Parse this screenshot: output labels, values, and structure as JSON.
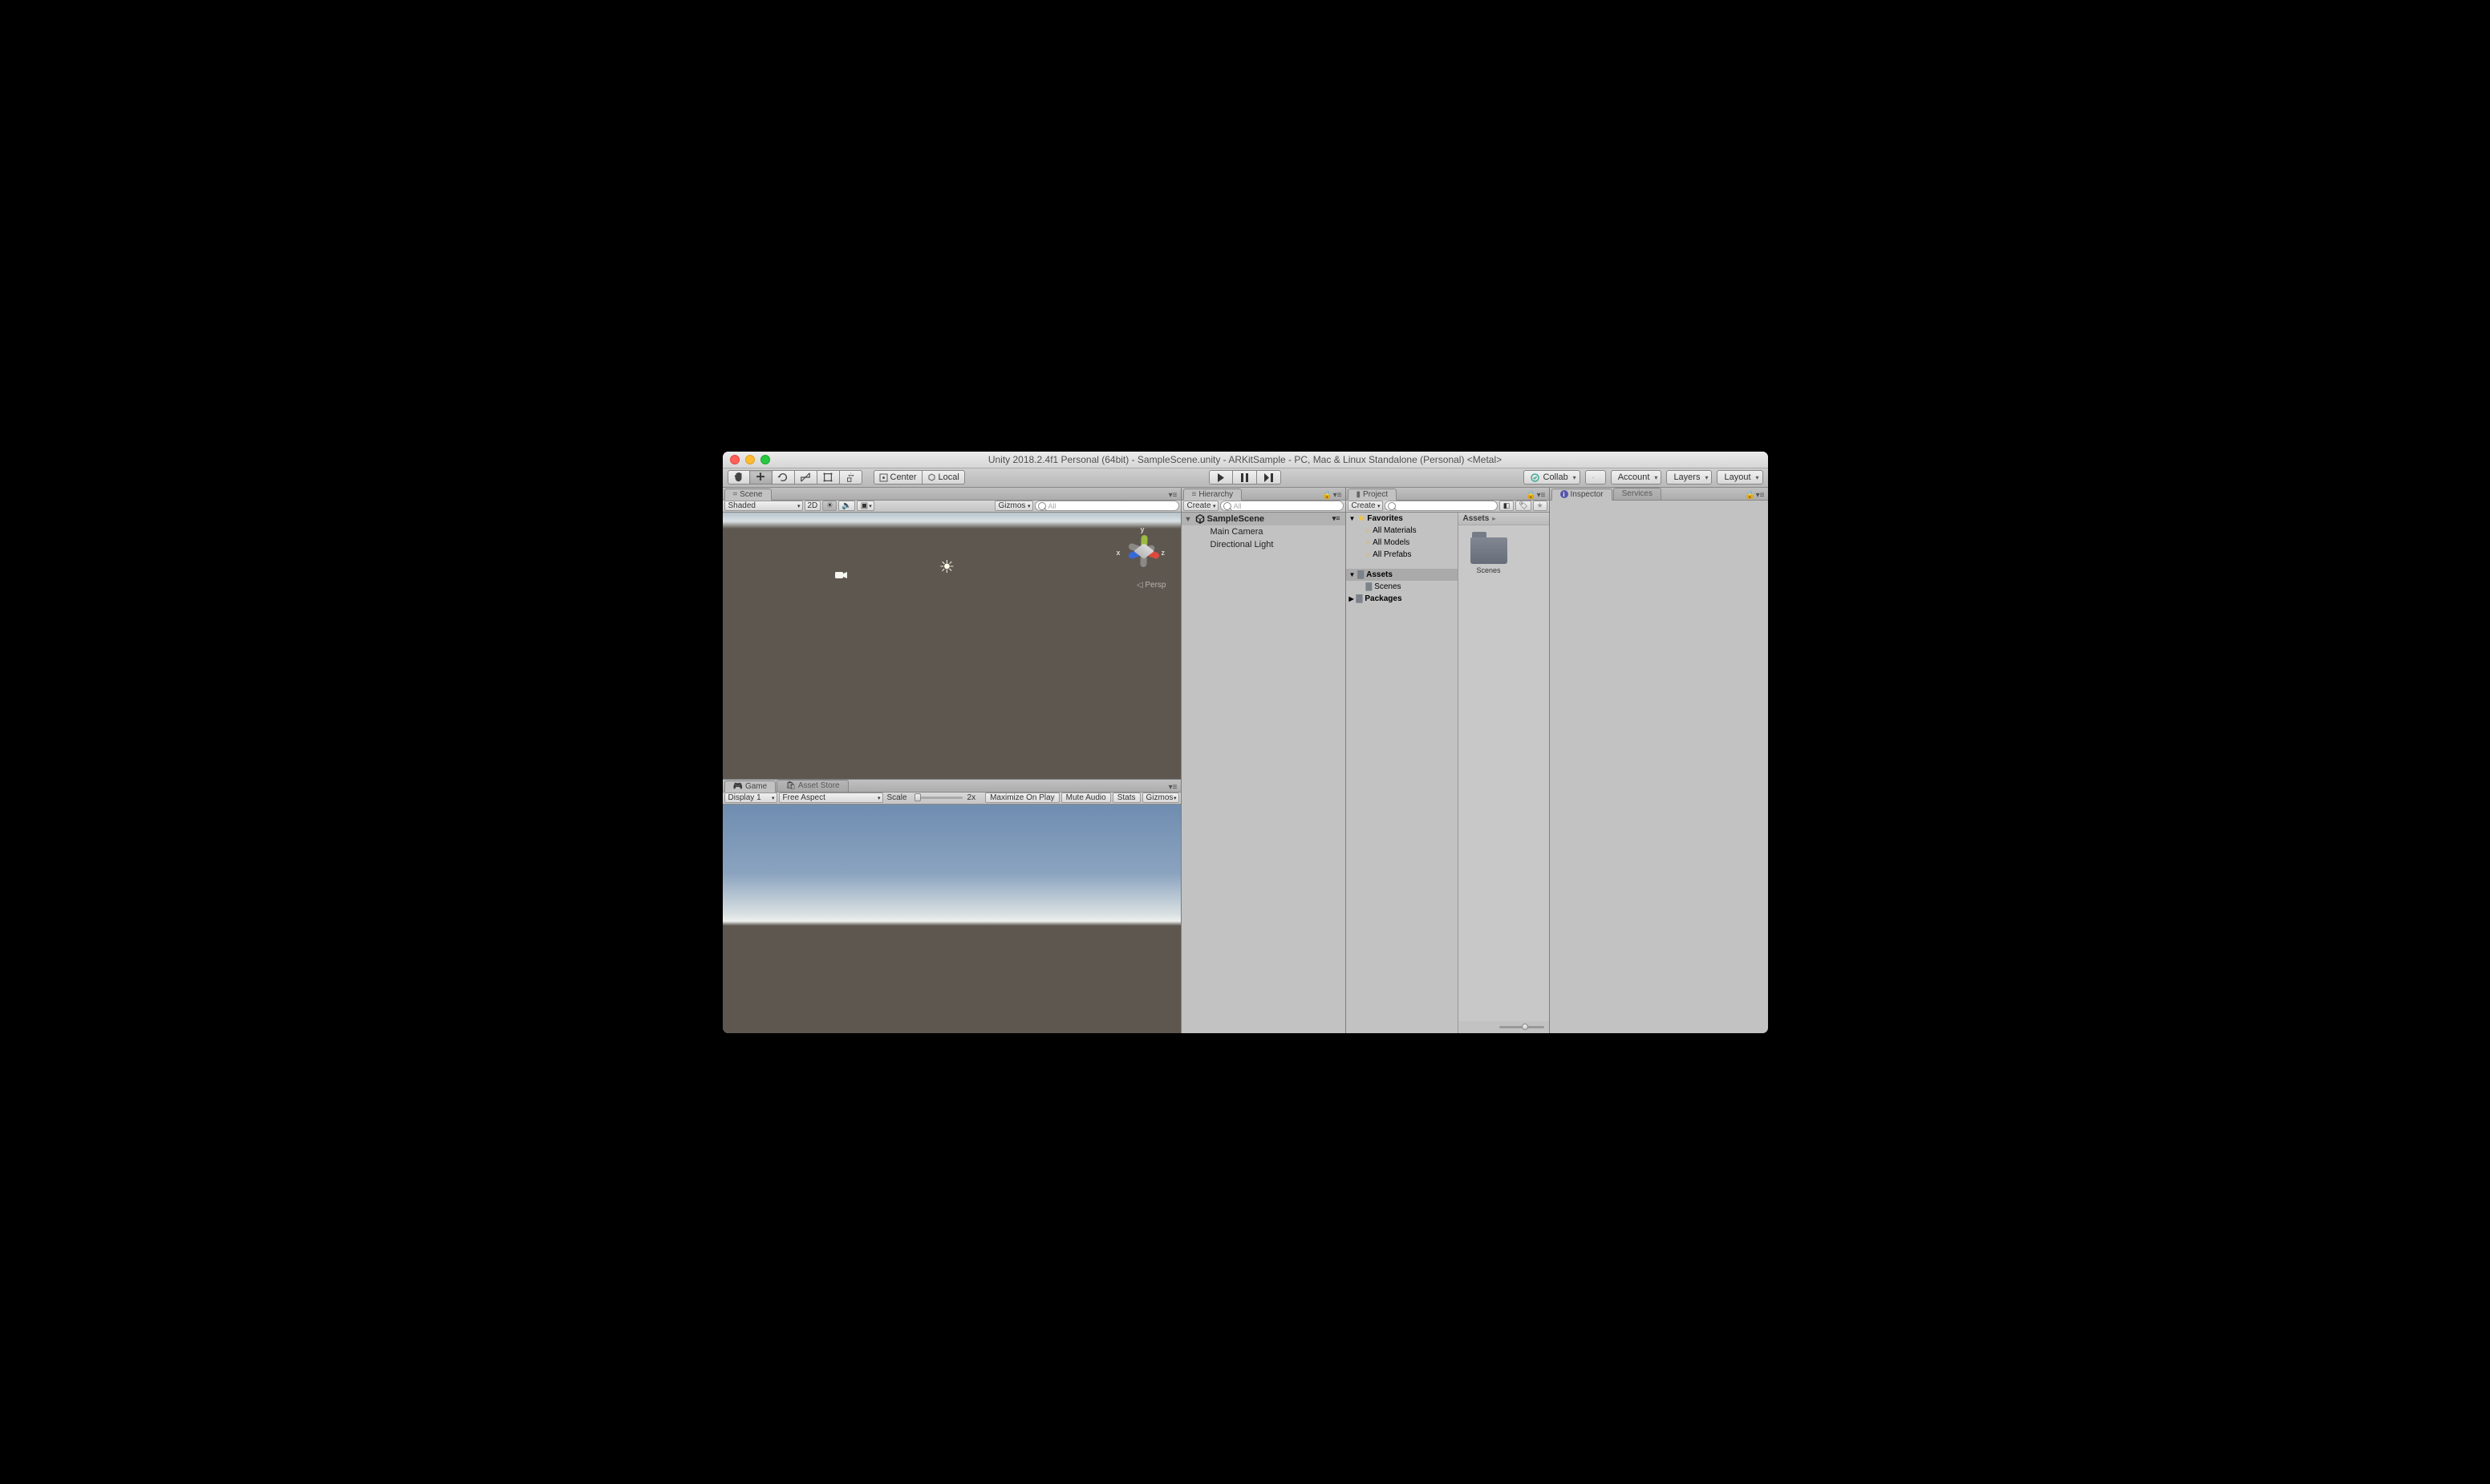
{
  "window": {
    "title": "Unity 2018.2.4f1 Personal (64bit) - SampleScene.unity - ARKitSample - PC, Mac & Linux Standalone (Personal) <Metal>"
  },
  "toolbar": {
    "pivot": "Center",
    "handle": "Local",
    "collab": "Collab",
    "account": "Account",
    "layers": "Layers",
    "layout": "Layout"
  },
  "scene_panel": {
    "tab": "Scene",
    "shading": "Shaded",
    "mode2d": "2D",
    "gizmos": "Gizmos",
    "search_placeholder": "All",
    "persp": "Persp",
    "axis": {
      "x": "x",
      "y": "y",
      "z": "z"
    }
  },
  "game_panel": {
    "tab_game": "Game",
    "tab_assetstore": "Asset Store",
    "display": "Display 1",
    "aspect": "Free Aspect",
    "scale_label": "Scale",
    "scale_mark": "2x",
    "maximize": "Maximize On Play",
    "mute": "Mute Audio",
    "stats": "Stats",
    "gizmos": "Gizmos"
  },
  "hierarchy": {
    "tab": "Hierarchy",
    "create": "Create",
    "search_placeholder": "All",
    "scene": "SampleScene",
    "items": [
      "Main Camera",
      "Directional Light"
    ]
  },
  "project": {
    "tab": "Project",
    "create": "Create",
    "favorites": "Favorites",
    "fav_items": [
      "All Materials",
      "All Models",
      "All Prefabs"
    ],
    "assets": "Assets",
    "folders": [
      "Scenes"
    ],
    "packages": "Packages",
    "breadcrumb": "Assets",
    "grid_items": [
      {
        "name": "Scenes"
      }
    ]
  },
  "inspector": {
    "tab": "Inspector",
    "tab2": "Services"
  }
}
